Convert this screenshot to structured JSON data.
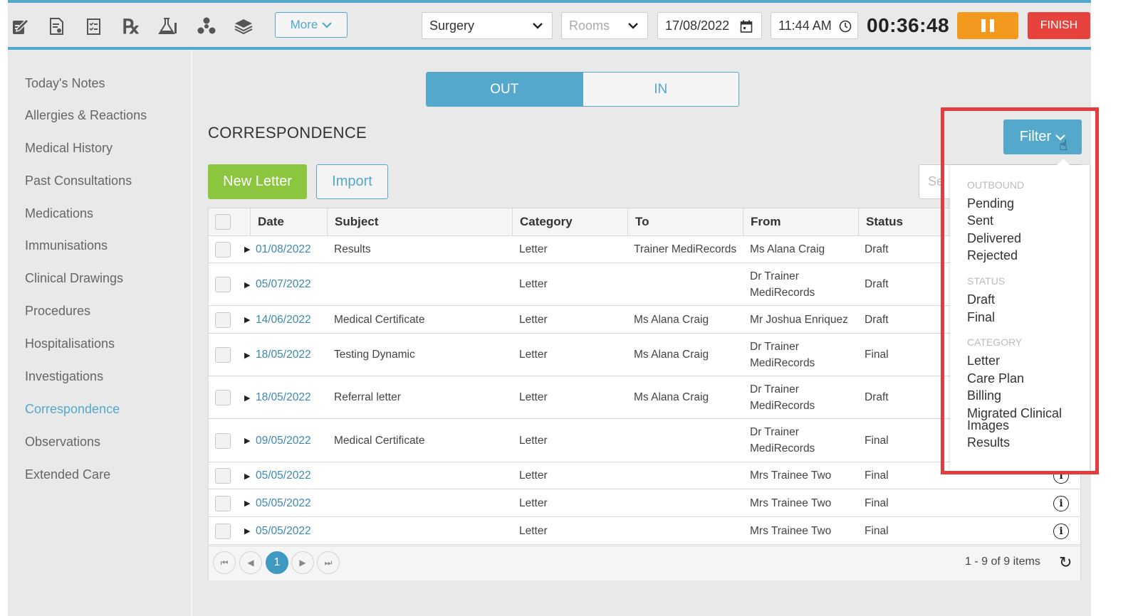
{
  "toolbar": {
    "icons": [
      "notes-icon",
      "document-icon",
      "checklist-icon",
      "rx-icon",
      "lab-flask-icon",
      "radiation-icon",
      "layers-icon"
    ],
    "rx_glyph": "℞",
    "more_label": "More",
    "location_value": "Surgery",
    "rooms_placeholder": "Rooms",
    "date_value": "17/08/2022",
    "time_value": "11:44 AM",
    "timer": "00:36:48",
    "finish_label": "FINISH",
    "colors": {
      "accent": "#54a8cc",
      "pause": "#f39a1e",
      "finish": "#e5433b",
      "new_letter": "#8cc63f"
    }
  },
  "sidebar": {
    "items": [
      {
        "label": "Today's Notes"
      },
      {
        "label": "Allergies & Reactions"
      },
      {
        "label": "Medical History"
      },
      {
        "label": "Past Consultations"
      },
      {
        "label": "Medications"
      },
      {
        "label": "Immunisations"
      },
      {
        "label": "Clinical Drawings"
      },
      {
        "label": "Procedures"
      },
      {
        "label": "Hospitalisations"
      },
      {
        "label": "Investigations"
      },
      {
        "label": "Correspondence"
      },
      {
        "label": "Observations"
      },
      {
        "label": "Extended Care"
      }
    ],
    "active": "Correspondence"
  },
  "main": {
    "toggle": {
      "out": "OUT",
      "in": "IN",
      "selected": "OUT"
    },
    "title": "CORRESPONDENCE",
    "new_letter_label": "New Letter",
    "import_label": "Import",
    "search_placeholder": "Se",
    "filter_label": "Filter",
    "columns": [
      "Date",
      "Subject",
      "Category",
      "To",
      "From",
      "Status"
    ],
    "rows": [
      {
        "date": "01/08/2022",
        "subject": "Results",
        "category": "Letter",
        "to": "Trainer MediRecords",
        "from": "Ms Alana Craig",
        "status": "Draft"
      },
      {
        "date": "05/07/2022",
        "subject": "",
        "category": "Letter",
        "to": "",
        "from": "Dr Trainer MediRecords",
        "status": "Draft"
      },
      {
        "date": "14/06/2022",
        "subject": "Medical Certificate",
        "category": "Letter",
        "to": "Ms Alana Craig",
        "from": "Mr Joshua Enriquez",
        "status": "Draft"
      },
      {
        "date": "18/05/2022",
        "subject": "Testing Dynamic",
        "category": "Letter",
        "to": "Ms Alana Craig",
        "from": "Dr Trainer MediRecords",
        "status": "Final"
      },
      {
        "date": "18/05/2022",
        "subject": "Referral letter",
        "category": "Letter",
        "to": "Ms Alana Craig",
        "from": "Dr Trainer MediRecords",
        "status": "Draft"
      },
      {
        "date": "09/05/2022",
        "subject": "Medical Certificate",
        "category": "Letter",
        "to": "",
        "from": "Dr Trainer MediRecords",
        "status": "Final"
      },
      {
        "date": "05/05/2022",
        "subject": "",
        "category": "Letter",
        "to": "",
        "from": "Mrs Trainee Two",
        "status": "Final"
      },
      {
        "date": "05/05/2022",
        "subject": "",
        "category": "Letter",
        "to": "",
        "from": "Mrs Trainee Two",
        "status": "Final"
      },
      {
        "date": "05/05/2022",
        "subject": "",
        "category": "Letter",
        "to": "",
        "from": "Mrs Trainee Two",
        "status": "Final"
      }
    ],
    "pager": {
      "current_page": "1",
      "info": "1 - 9 of 9 items"
    }
  },
  "filter_menu": {
    "outbound_header": "OUTBOUND",
    "outbound": [
      "Pending",
      "Sent",
      "Delivered",
      "Rejected"
    ],
    "status_header": "STATUS",
    "status": [
      "Draft",
      "Final"
    ],
    "category_header": "CATEGORY",
    "category": [
      "Letter",
      "Care Plan",
      "Billing",
      "Migrated Clinical Images",
      "Results"
    ]
  }
}
